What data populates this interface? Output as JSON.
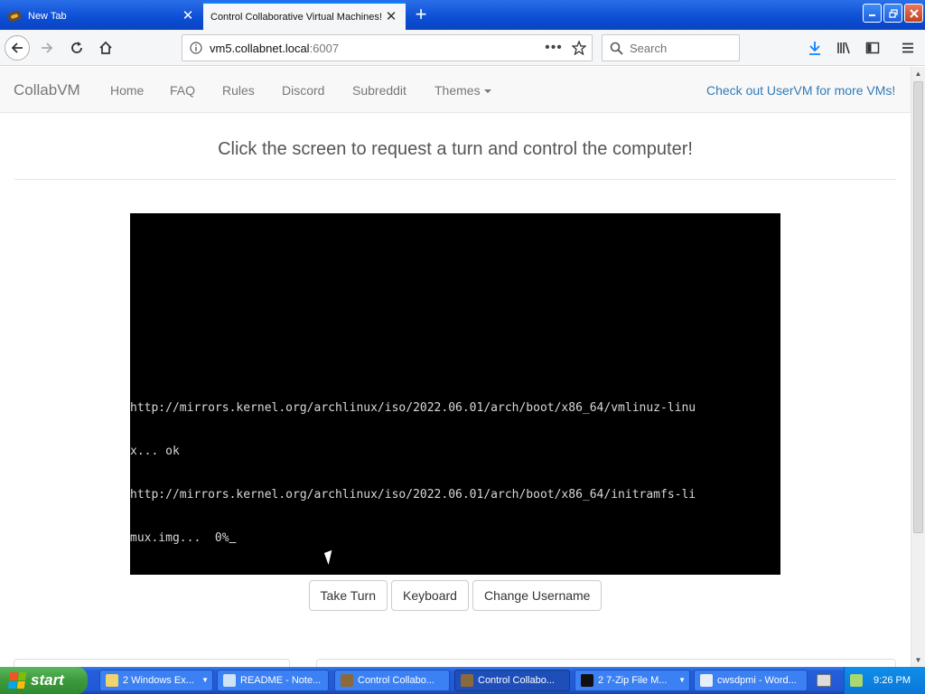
{
  "browser": {
    "tabs": [
      {
        "label": "New Tab",
        "active": false
      },
      {
        "label": "Control Collaborative Virtual Machines!",
        "active": true
      }
    ],
    "new_tab_symbol": "+",
    "url_host": "vm5.collabnet.local",
    "url_port": ":6007",
    "page_actions_symbol": "•••",
    "search_placeholder": "Search"
  },
  "site": {
    "brand": "CollabVM",
    "nav": [
      "Home",
      "FAQ",
      "Rules",
      "Discord",
      "Subreddit",
      "Themes"
    ],
    "uservm_link": "Check out UserVM for more VMs!",
    "heading": "Click the screen to request a turn and control the computer!",
    "console_lines": [
      "http://mirrors.kernel.org/archlinux/iso/2022.06.01/arch/boot/x86_64/vmlinuz-linu",
      "x... ok",
      "http://mirrors.kernel.org/archlinux/iso/2022.06.01/arch/boot/x86_64/initramfs-li",
      "mux.img...  0%"
    ],
    "buttons": {
      "take_turn": "Take Turn",
      "keyboard": "Keyboard",
      "change_username": "Change Username"
    }
  },
  "taskbar": {
    "start": "start",
    "tasks": [
      {
        "label": "2 Windows Ex...",
        "active": false,
        "grouped": true
      },
      {
        "label": "README - Note...",
        "active": false,
        "grouped": false
      },
      {
        "label": "Control Collabo...",
        "active": false,
        "grouped": false
      },
      {
        "label": "Control Collabo...",
        "active": true,
        "grouped": false
      },
      {
        "label": "2 7-Zip File M...",
        "active": false,
        "grouped": true
      },
      {
        "label": "cwsdpmi - Word...",
        "active": false,
        "grouped": false
      }
    ],
    "clock": "9:26 PM"
  },
  "colors": {
    "firefox_tabstrip": "#0d4ed4",
    "link_blue": "#337ab7",
    "xp_taskbar": "#245edb",
    "xp_start_green": "#3c9a3c"
  }
}
